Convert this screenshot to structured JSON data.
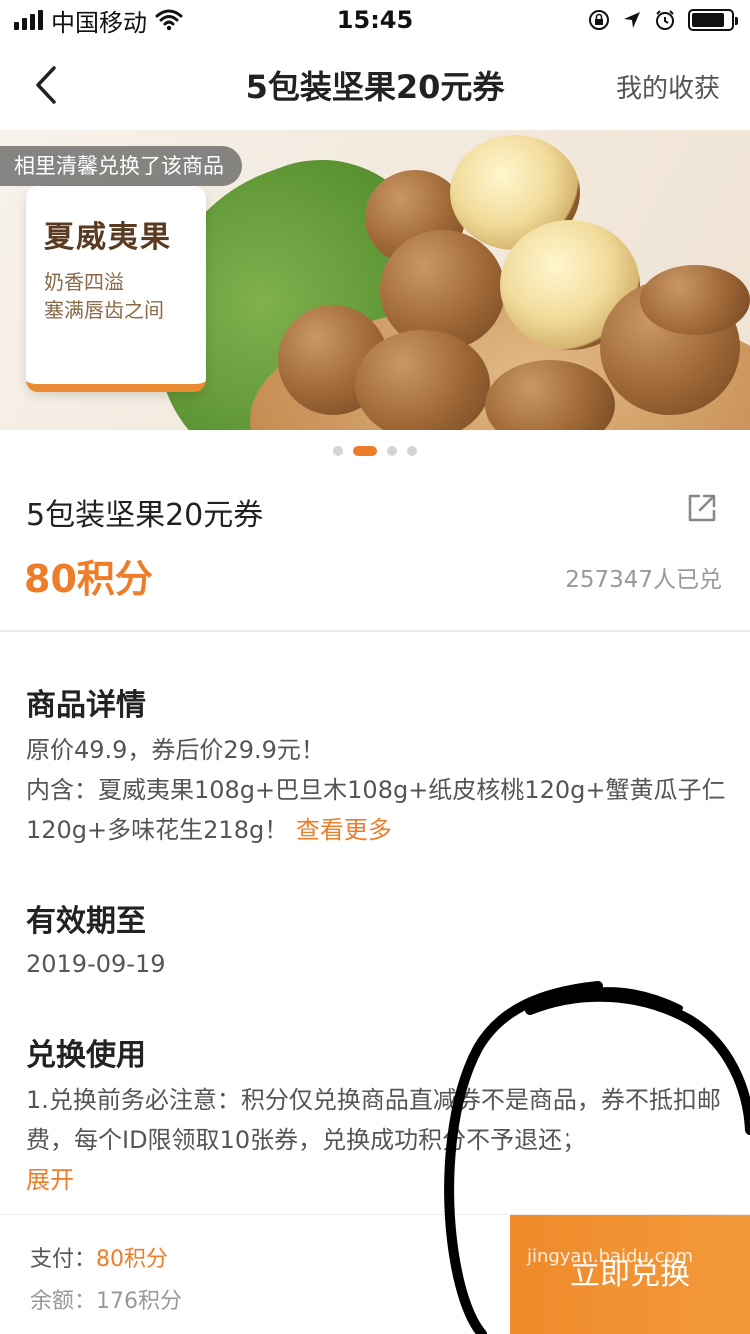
{
  "status_bar": {
    "carrier": "中国移动",
    "time": "15:45",
    "battery_level": 0.85
  },
  "nav": {
    "title": "5包装坚果20元券",
    "right_label": "我的收获"
  },
  "banner": {
    "exchange_tip": "相里清馨兑换了该商品",
    "card_title": "夏威夷果",
    "card_line1": "奶香四溢",
    "card_line2": "塞满唇齿之间",
    "page_count": 4,
    "active_page": 2
  },
  "product": {
    "name": "5包装坚果20元券",
    "points": "80积分",
    "exchanged_count": "257347人已兑"
  },
  "details": {
    "title": "商品详情",
    "line1": "原价49.9，券后价29.9元！",
    "line2": "内含：夏威夷果108g+巴旦木108g+纸皮核桃120g+蟹黄瓜子仁120g+多味花生218g！",
    "more": "查看更多"
  },
  "validity": {
    "title": "有效期至",
    "date": "2019-09-19"
  },
  "usage": {
    "title": "兑换使用",
    "text": "1.兑换前务必注意：积分仅兑换商品直减券不是商品，券不抵扣邮费，每个ID限领取10张券，兑换成功积分不予退还；",
    "expand": "展开"
  },
  "bottom": {
    "pay_label": "支付：",
    "pay_value": "80积分",
    "balance_label": "余额：",
    "balance_value": "176积分",
    "redeem": "立即兑换",
    "watermark": "Baidu经验 jingyan.baidu.com"
  },
  "colors": {
    "accent": "#ee7d2a",
    "annotation": "#000000"
  }
}
